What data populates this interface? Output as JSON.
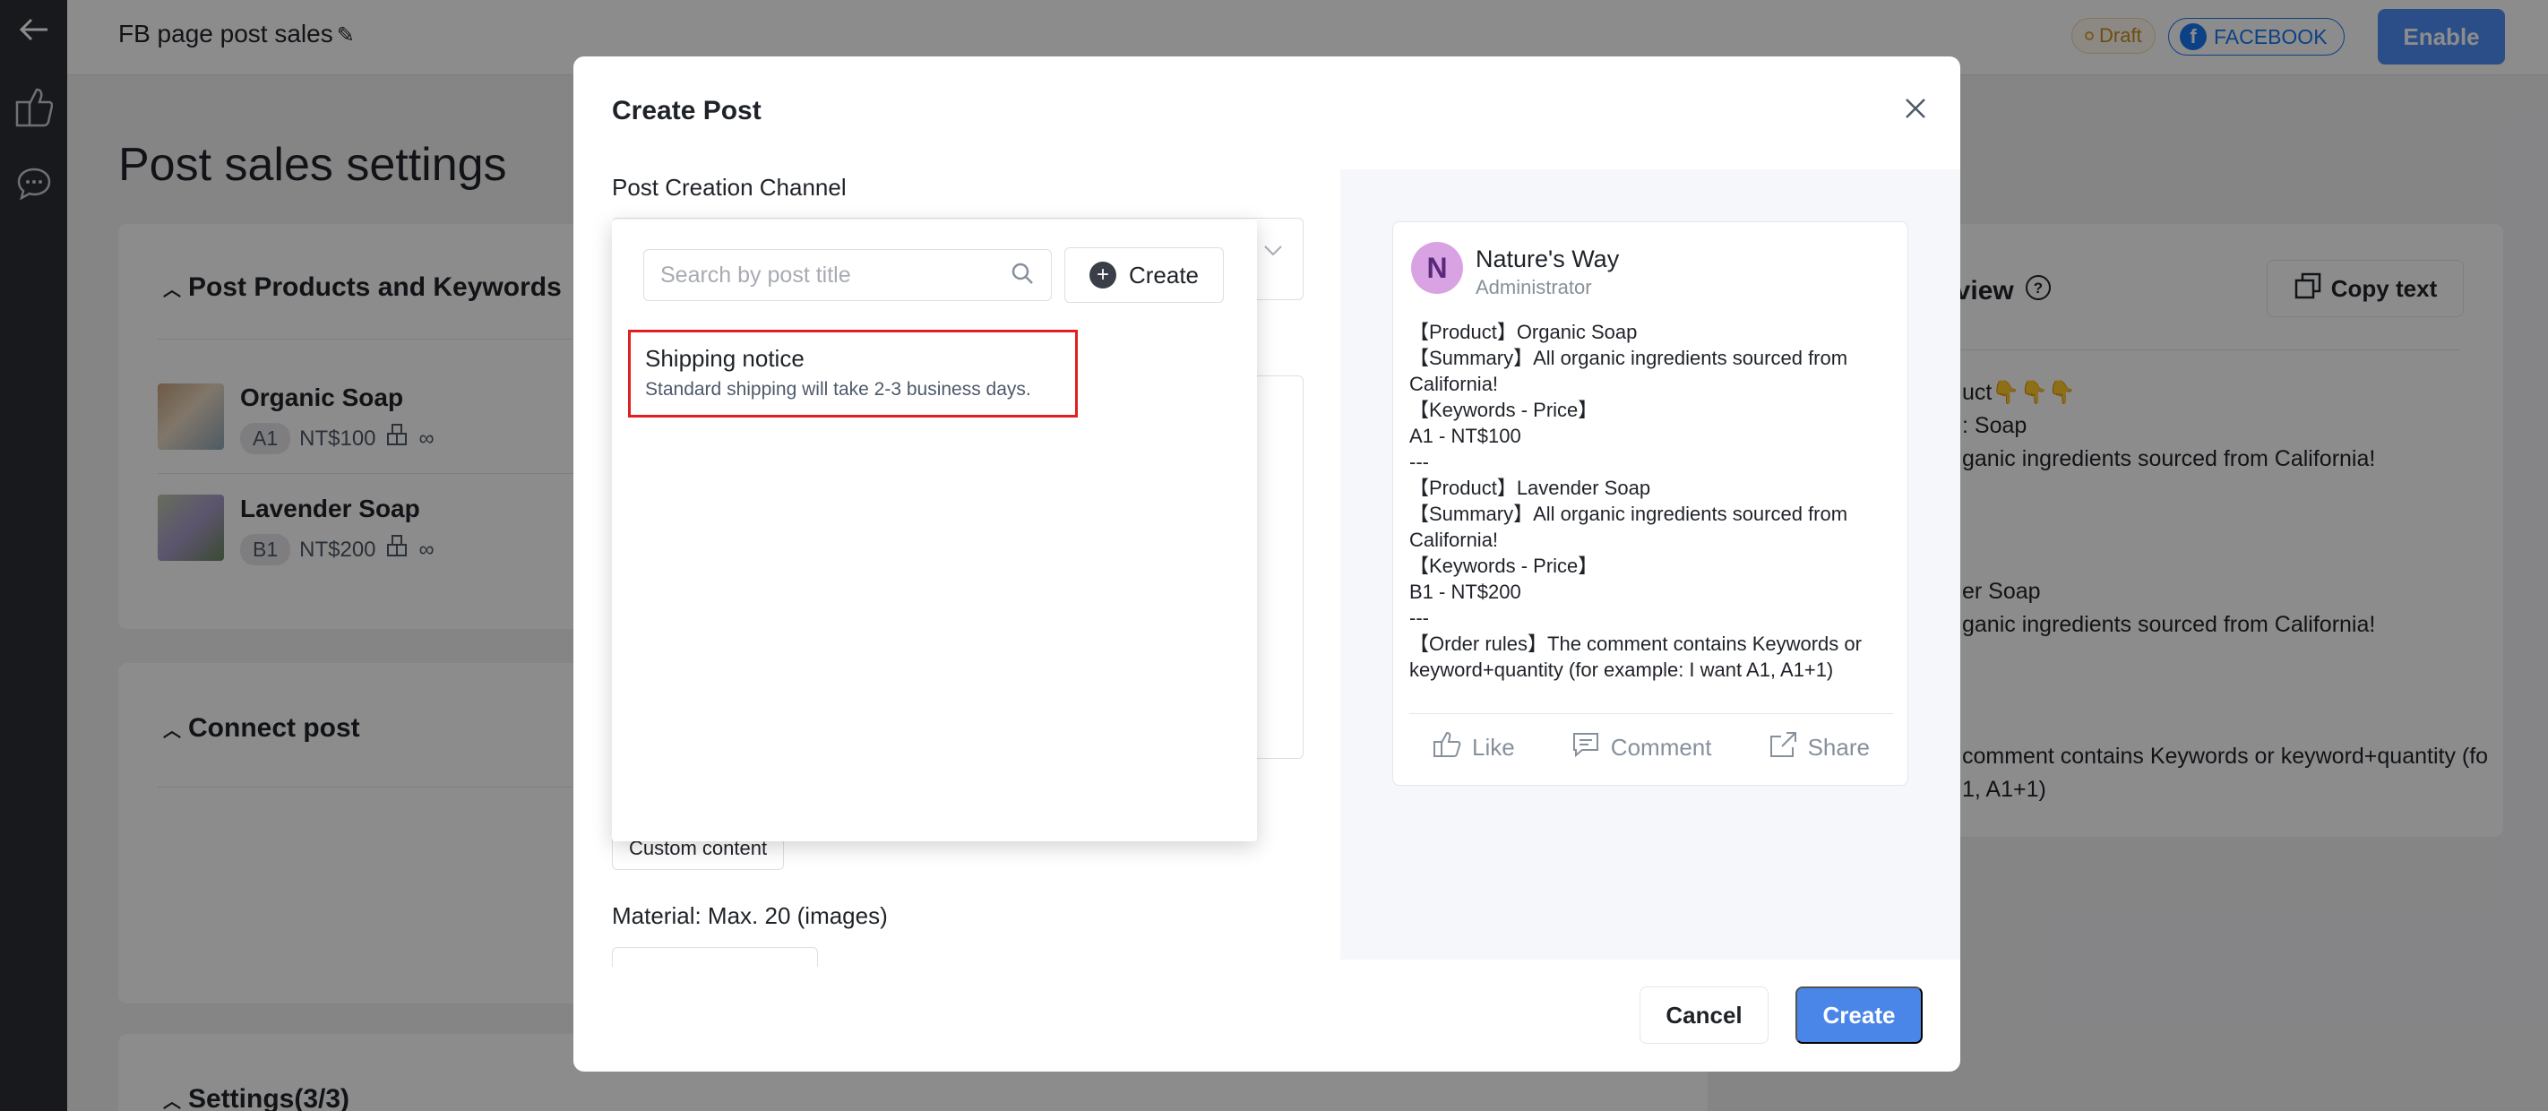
{
  "header": {
    "title": "FB page post sales",
    "status_badge": "Draft",
    "channel_badge": "FACEBOOK",
    "enable_label": "Enable"
  },
  "page": {
    "title": "Post sales settings"
  },
  "sections": {
    "products_title": "Post Products and Keywords",
    "connect_title": "Connect post",
    "settings_title": "Settings(3/3)",
    "preview_title": "eview",
    "copy_text_label": "Copy text"
  },
  "products": [
    {
      "name": "Organic Soap",
      "keyword": "A1",
      "price": "NT$100",
      "stock": "∞"
    },
    {
      "name": "Lavender Soap",
      "keyword": "B1",
      "price": "NT$200",
      "stock": "∞"
    }
  ],
  "bg_preview_lines": [
    "uct👇👇👇",
    ": Soap",
    "ganic ingredients sourced from California!",
    "er Soap",
    "ganic ingredients sourced from California!",
    "comment contains Keywords or keyword+quantity (fo",
    "1, A1+1)"
  ],
  "modal": {
    "title": "Create Post",
    "channel_label": "Post Creation Channel",
    "custom_content_label": "Custom content",
    "material_label": "Material: Max. 20 (images)",
    "cancel_label": "Cancel",
    "create_label": "Create"
  },
  "dropdown": {
    "search_placeholder": "Search by post title",
    "create_label": "Create",
    "items": [
      {
        "title": "Shipping notice",
        "description": "Standard shipping will take 2-3 business days."
      }
    ]
  },
  "post_preview": {
    "avatar_letter": "N",
    "page_name": "Nature's Way",
    "role": "Administrator",
    "lines": [
      "【Product】Organic Soap",
      "【Summary】All organic ingredients sourced from California!",
      "【Keywords - Price】",
      "A1 - NT$100",
      "---",
      "【Product】Lavender Soap",
      "【Summary】All organic ingredients sourced from California!",
      "【Keywords - Price】",
      "B1 - NT$200",
      "---",
      "【Order rules】The comment contains Keywords or keyword+quantity (for example: I want A1, A1+1)"
    ],
    "actions": {
      "like": "Like",
      "comment": "Comment",
      "share": "Share"
    }
  },
  "colors": {
    "accent": "#4a86e8",
    "facebook": "#1877f2",
    "highlight_border": "#e02020",
    "rail": "#2b2f36"
  },
  "icons": [
    "back-arrow-icon",
    "thumbs-up-nav-icon",
    "chat-bubble-icon",
    "pencil-icon",
    "facebook-icon",
    "close-icon",
    "search-icon",
    "plus-icon",
    "chevron-down-icon",
    "copy-icon",
    "help-icon",
    "like-icon",
    "comment-icon",
    "share-icon",
    "stock-icon"
  ]
}
